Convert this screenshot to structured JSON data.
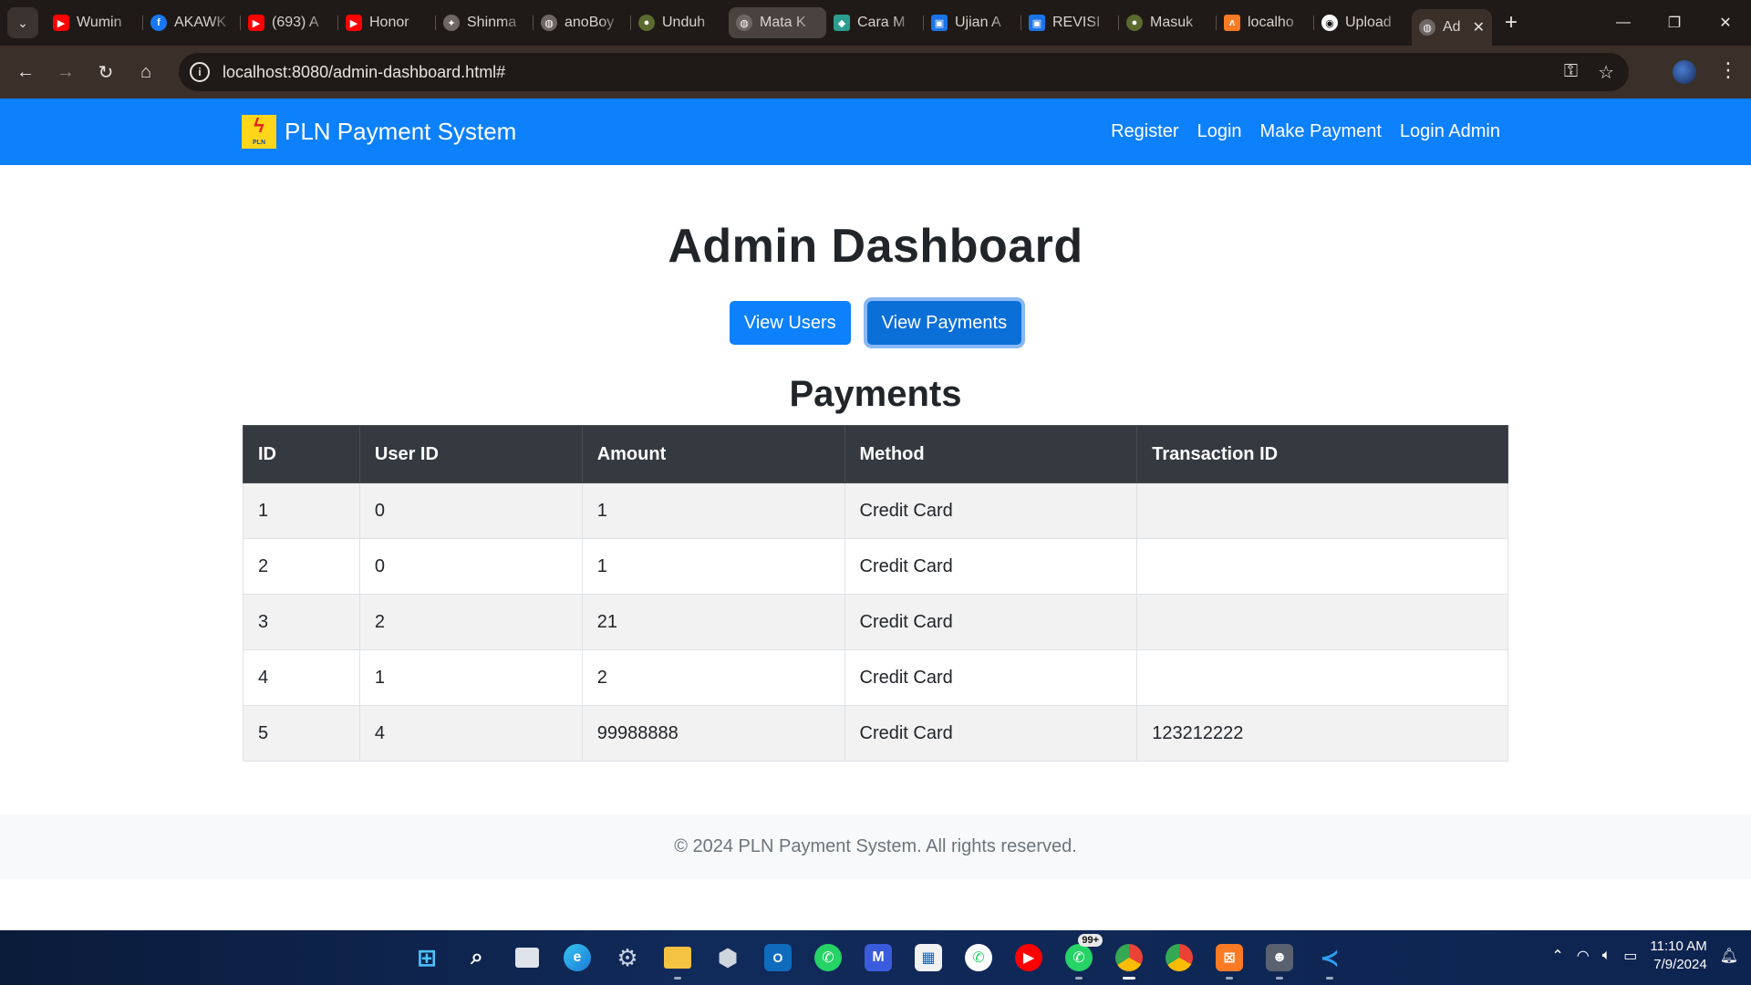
{
  "browser": {
    "tabs": [
      {
        "label": "Wumin",
        "icon": "youtube-icon"
      },
      {
        "label": "AKAWK",
        "icon": "facebook-icon"
      },
      {
        "label": "(693) A",
        "icon": "youtube-icon"
      },
      {
        "label": "Honor",
        "icon": "youtube-icon"
      },
      {
        "label": "Shinma",
        "icon": "site-icon"
      },
      {
        "label": "anoBoy",
        "icon": "globe-icon"
      },
      {
        "label": "Unduh",
        "icon": "site-icon"
      },
      {
        "label": "Mata K",
        "icon": "globe-icon"
      },
      {
        "label": "Cara M",
        "icon": "site-icon"
      },
      {
        "label": "Ujian A",
        "icon": "classroom-icon"
      },
      {
        "label": "REVISI",
        "icon": "classroom-icon"
      },
      {
        "label": "Masuk",
        "icon": "site-icon"
      },
      {
        "label": "localho",
        "icon": "xampp-icon"
      },
      {
        "label": "Upload",
        "icon": "github-icon"
      }
    ],
    "active_tab": {
      "label": "Ad",
      "icon": "globe-icon"
    },
    "url": "localhost:8080/admin-dashboard.html#"
  },
  "navbar": {
    "brand": "PLN Payment System",
    "logo_text": "PLN",
    "links": [
      "Register",
      "Login",
      "Make Payment",
      "Login Admin"
    ]
  },
  "page": {
    "title": "Admin Dashboard",
    "buttons": {
      "view_users": "View Users",
      "view_payments": "View Payments"
    },
    "section_title": "Payments"
  },
  "table": {
    "headers": [
      "ID",
      "User ID",
      "Amount",
      "Method",
      "Transaction ID"
    ],
    "rows": [
      [
        "1",
        "0",
        "1",
        "Credit Card",
        ""
      ],
      [
        "2",
        "0",
        "1",
        "Credit Card",
        ""
      ],
      [
        "3",
        "2",
        "21",
        "Credit Card",
        ""
      ],
      [
        "4",
        "1",
        "2",
        "Credit Card",
        ""
      ],
      [
        "5",
        "4",
        "99988888",
        "Credit Card",
        "123212222"
      ]
    ]
  },
  "footer": {
    "text": "© 2024 PLN Payment System. All rights reserved."
  },
  "taskbar": {
    "badge": "99+",
    "time": "11:10 AM",
    "date": "7/9/2024"
  },
  "colors": {
    "primary": "#0d80fb",
    "table_header": "#343a40",
    "footer_bg": "#f8f9fa"
  }
}
